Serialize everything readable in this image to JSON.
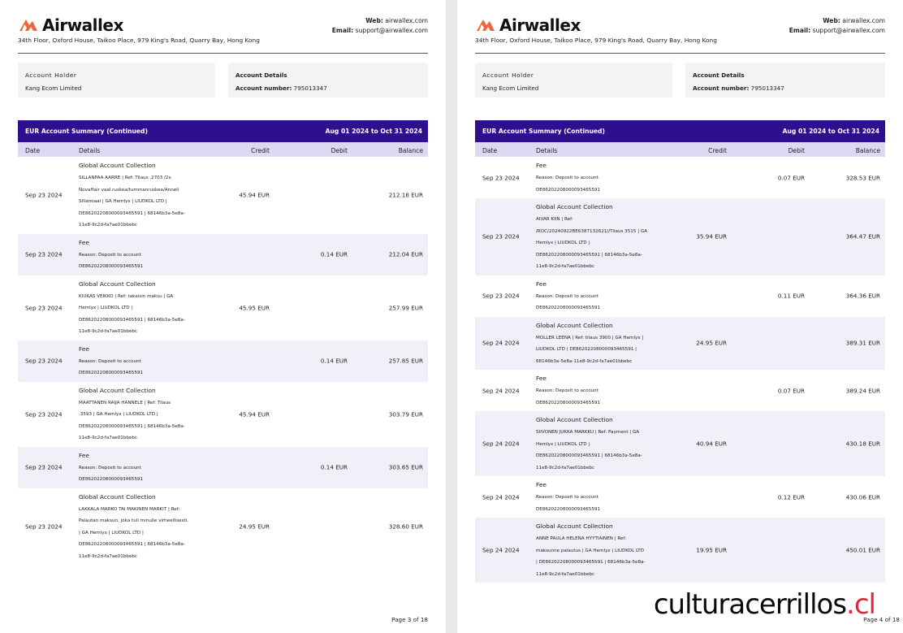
{
  "brand": {
    "name": "Airwallex",
    "address": "34th Floor, Oxford House, Taikoo Place, 979 King's Road, Quarry Bay, Hong Kong",
    "web_label": "Web:",
    "web": "airwallex.com",
    "email_label": "Email:",
    "email": "support@airwallex.com",
    "logo_color": "#f0653b"
  },
  "account_holder": {
    "label": "Account Holder",
    "value": "Kang Ecom Limited"
  },
  "account_details": {
    "label": "Account Details",
    "number_label": "Account number:",
    "number": "795013347"
  },
  "summary": {
    "title": "EUR Account Summary (Continued)",
    "period": "Aug 01 2024 to Oct 31 2024"
  },
  "columns": {
    "date": "Date",
    "details": "Details",
    "credit": "Credit",
    "debit": "Debit",
    "balance": "Balance"
  },
  "colors": {
    "summary_bar": "#2e0f8f",
    "column_header": "#dcdaf3",
    "row_alt": "#f0f0f8",
    "watermark_accent": "#e2273b"
  },
  "pages": [
    {
      "footer": "Page 3 of 18",
      "rows": [
        {
          "date": "Sep 23 2024",
          "title": "Global Account Collection",
          "lines": [
            "SILLANPAA AARRE | Ref: Tilaus .2703 /2x",
            "NovaHair vaal.ruskea/tummanruskea/Anneli",
            "Sillanoaai | GA Hemlyx | LIUDKOL LTD |",
            "DE86202208000093465591 | 68146b3a-5e8a-",
            "11e8-9c2d-fa7ae01bbebc"
          ],
          "credit": "45.94 EUR",
          "debit": "",
          "balance": "212.18 EUR"
        },
        {
          "date": "Sep 23 2024",
          "title": "Fee",
          "lines": [
            "Reason: Deposit to account",
            "DE86202208000093465591"
          ],
          "credit": "",
          "debit": "0.14 EUR",
          "balance": "212.04 EUR"
        },
        {
          "date": "Sep 23 2024",
          "title": "Global Account Collection",
          "lines": [
            "KIUKAS VEIKKO | Ref: takaisin maksu | GA",
            "Hemlyx | LIUDKOL LTD |",
            "DE86202208000093465591 | 68146b3a-5e8a-",
            "11e8-9c2d-fa7ae01bbebc"
          ],
          "credit": "45.95 EUR",
          "debit": "",
          "balance": "257.99 EUR"
        },
        {
          "date": "Sep 23 2024",
          "title": "Fee",
          "lines": [
            "Reason: Deposit to account",
            "DE86202208000093465591"
          ],
          "credit": "",
          "debit": "0.14 EUR",
          "balance": "257.85 EUR"
        },
        {
          "date": "Sep 23 2024",
          "title": "Global Account Collection",
          "lines": [
            "MAATTANEN RAIJA HANNELE | Ref: Tilaus",
            ".3593 | GA Hemlyx | LIUDKOL LTD |",
            "DE86202208000093465591 | 68146b3a-5e8a-",
            "11e8-9c2d-fa7ae01bbebc"
          ],
          "credit": "45.94 EUR",
          "debit": "",
          "balance": "303.79 EUR"
        },
        {
          "date": "Sep 23 2024",
          "title": "Fee",
          "lines": [
            "Reason: Deposit to account",
            "DE86202208000093465591"
          ],
          "credit": "",
          "debit": "0.14 EUR",
          "balance": "303.65 EUR"
        },
        {
          "date": "Sep 23 2024",
          "title": "Global Account Collection",
          "lines": [
            "LAKKALA MARKO TAI MAKINEN MARKIT | Ref:",
            "Palautan maksun, joka tuli minulle virheellisesti.",
            "| GA Hemlyx | LIUDKOL LTD |",
            "DE86202208000093465591 | 68146b3a-5e8a-",
            "11e8-9c2d-fa7ae01bbebc"
          ],
          "credit": "24.95 EUR",
          "debit": "",
          "balance": "328.60 EUR"
        }
      ]
    },
    {
      "footer": "Page 4 of 18",
      "rows": [
        {
          "date": "Sep 23 2024",
          "title": "Fee",
          "lines": [
            "Reason: Deposit to account",
            "DE86202208000093465591"
          ],
          "credit": "",
          "debit": "0.07 EUR",
          "balance": "328.53 EUR"
        },
        {
          "date": "Sep 23 2024",
          "title": "Global Account Collection",
          "lines": [
            "AIVAR KIIN | Ref:",
            "/ROC/20240922BE6387132621//Tilaus 3515 | GA",
            "Hemlyx | LIUDKOL LTD |",
            "DE86202208000093465591 | 68146b3a-5e8a-",
            "11e8-9c2d-fa7ae01bbebc"
          ],
          "credit": "35.94 EUR",
          "debit": "",
          "balance": "364.47 EUR"
        },
        {
          "date": "Sep 23 2024",
          "title": "Fee",
          "lines": [
            "Reason: Deposit to account",
            "DE86202208000093465591"
          ],
          "credit": "",
          "debit": "0.11 EUR",
          "balance": "364.36 EUR"
        },
        {
          "date": "Sep 24 2024",
          "title": "Global Account Collection",
          "lines": [
            "MOLLER LEENA | Ref: tilaus 3900 | GA Hemlyx |",
            "LIUDKOL LTD | DE86202208000093465591 |",
            "68146b3a-5e8a-11e8-9c2d-fa7ae01bbebc"
          ],
          "credit": "24.95 EUR",
          "debit": "",
          "balance": "389.31 EUR"
        },
        {
          "date": "Sep 24 2024",
          "title": "Fee",
          "lines": [
            "Reason: Deposit to account",
            "DE86202208000093465591"
          ],
          "credit": "",
          "debit": "0.07 EUR",
          "balance": "389.24 EUR"
        },
        {
          "date": "Sep 24 2024",
          "title": "Global Account Collection",
          "lines": [
            "SIIVONEN JUKKA MARKKU | Ref: Payment | GA",
            "Hemlyx | LIUDKOL LTD |",
            "DE86202208000093465591 | 68146b3a-5e8a-",
            "11e8-9c2d-fa7ae01bbebc"
          ],
          "credit": "40.94 EUR",
          "debit": "",
          "balance": "430.18 EUR"
        },
        {
          "date": "Sep 24 2024",
          "title": "Fee",
          "lines": [
            "Reason: Deposit to account",
            "DE86202208000093465591"
          ],
          "credit": "",
          "debit": "0.12 EUR",
          "balance": "430.06 EUR"
        },
        {
          "date": "Sep 24 2024",
          "title": "Global Account Collection",
          "lines": [
            "ANNE PAULA HELENA HYYTIAINEN | Ref:",
            "maksunne palautus | GA Hemlyx | LIUDKOL LTD",
            "| DE86202208000093465591 | 68146b3a-5e8a-",
            "11e8-9c2d-fa7ae01bbebc"
          ],
          "credit": "19.95 EUR",
          "debit": "",
          "balance": "450.01 EUR"
        }
      ]
    }
  ],
  "watermark": {
    "text": "culturacerrillos",
    "suffix": ".cl"
  }
}
